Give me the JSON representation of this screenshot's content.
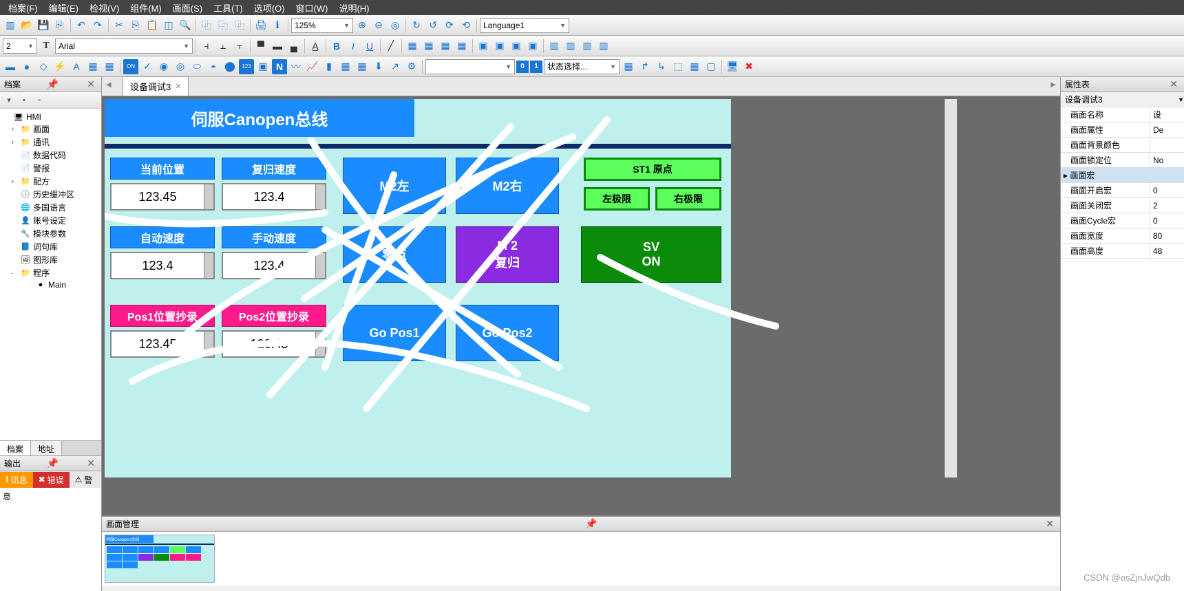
{
  "menu": [
    "档案(F)",
    "编辑(E)",
    "检视(V)",
    "组件(M)",
    "画面(S)",
    "工具(T)",
    "选项(O)",
    "窗口(W)",
    "说明(H)"
  ],
  "toolbar1": {
    "zoom": "125%",
    "language": "Language1"
  },
  "toolbar2": {
    "fontsize": "2",
    "font_type_prefix": "T",
    "font": "Arial",
    "bold": "B",
    "italic": "I",
    "underline": "U"
  },
  "toolbar3": {
    "num0": "0",
    "num1": "1",
    "state_select": "状态选择...",
    "combo_empty": ""
  },
  "left_panel": {
    "title": "档案",
    "tabs": [
      "档案",
      "地址"
    ],
    "tree": [
      {
        "label": "HMI",
        "icon": "monitor",
        "lvl": 0,
        "expand": ""
      },
      {
        "label": "画面",
        "icon": "folder",
        "lvl": 1,
        "expand": "+"
      },
      {
        "label": "通讯",
        "icon": "folder",
        "lvl": 1,
        "expand": "+"
      },
      {
        "label": "数据代码",
        "icon": "doc",
        "lvl": 1,
        "expand": ""
      },
      {
        "label": "警报",
        "icon": "doc",
        "lvl": 1,
        "expand": ""
      },
      {
        "label": "配方",
        "icon": "folder",
        "lvl": 1,
        "expand": "+"
      },
      {
        "label": "历史缓冲区",
        "icon": "clock",
        "lvl": 1,
        "expand": ""
      },
      {
        "label": "多国语言",
        "icon": "globe",
        "lvl": 1,
        "expand": ""
      },
      {
        "label": "账号设定",
        "icon": "user",
        "lvl": 1,
        "expand": ""
      },
      {
        "label": "模块参数",
        "icon": "wrench",
        "lvl": 1,
        "expand": ""
      },
      {
        "label": "词句库",
        "icon": "dict",
        "lvl": 1,
        "expand": ""
      },
      {
        "label": "图形库",
        "icon": "pic",
        "lvl": 1,
        "expand": ""
      },
      {
        "label": "程序",
        "icon": "folder",
        "lvl": 1,
        "expand": "-"
      },
      {
        "label": "Main",
        "icon": "code",
        "lvl": 2,
        "expand": ""
      }
    ]
  },
  "output_panel": {
    "title": "输出",
    "tabs": [
      {
        "label": "讯息",
        "kind": "orange",
        "icon": "!"
      },
      {
        "label": "错误",
        "kind": "redbg",
        "icon": "✖"
      },
      {
        "label": "警",
        "kind": "plain",
        "icon": "⚠"
      }
    ],
    "row": "息"
  },
  "doc_tab": {
    "label": "设备调试3"
  },
  "hmi": {
    "title": "伺服Canopen总线",
    "labels": {
      "cur_pos": "当前位置",
      "reset_spd": "复归速度",
      "auto_spd": "自动速度",
      "manual_spd": "手动速度",
      "m2_left": "M2左",
      "m2_right": "M2右",
      "zero": "零点",
      "m2_reset_l1": "M  2",
      "m2_reset_l2": "复归",
      "st1_origin": "ST1 原点",
      "left_limit": "左极限",
      "right_limit": "右极限",
      "sv_on_l1": "SV",
      "sv_on_l2": "ON",
      "pos1_copy": "Pos1位置抄录",
      "pos2_copy": "Pos2位置抄录",
      "go_pos1": "Go Pos1",
      "go_pos2": "Go Pos2"
    },
    "values": {
      "v_curpos": "123.45",
      "v_resetspd": "123.4",
      "v_autospd": "123.4",
      "v_manspd": "123.4",
      "v_pos1": "123.45",
      "v_pos2": "123.45"
    }
  },
  "screen_mgr": {
    "title": "画面管理"
  },
  "right_panel": {
    "title": "属性表",
    "header": "设备调试3",
    "rows": [
      {
        "k": "画面名称",
        "v": "设"
      },
      {
        "k": "画面属性",
        "v": "De"
      },
      {
        "k": "画面背景颜色",
        "v": " "
      },
      {
        "k": "画面锁定位",
        "v": "No"
      },
      {
        "k": "画面宏",
        "v": "",
        "group": true
      },
      {
        "k": "画面开启宏",
        "v": "0"
      },
      {
        "k": "画面关闭宏",
        "v": "2"
      },
      {
        "k": "画面Cycle宏",
        "v": "0"
      },
      {
        "k": "画面宽度",
        "v": "80"
      },
      {
        "k": "画面高度",
        "v": "48"
      }
    ]
  },
  "watermark": "CSDN @osZjnJwQdb"
}
